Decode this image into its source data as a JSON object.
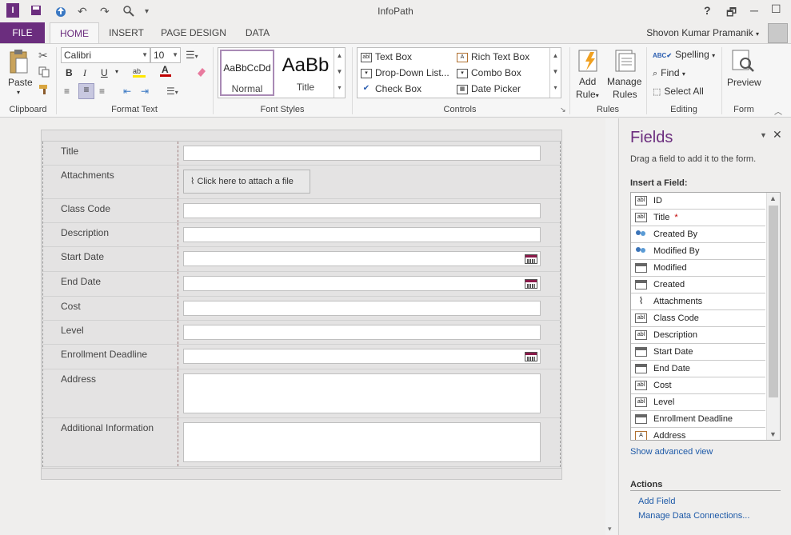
{
  "app": {
    "title": "InfoPath"
  },
  "window_controls": {
    "help": "?",
    "restore": "🗗",
    "minimize": "─",
    "maximize": "☐",
    "close": "✕"
  },
  "tabs": [
    {
      "label": "FILE"
    },
    {
      "label": "HOME"
    },
    {
      "label": "INSERT"
    },
    {
      "label": "PAGE DESIGN"
    },
    {
      "label": "DATA"
    }
  ],
  "user": {
    "name": "Shovon Kumar Pramanik"
  },
  "ribbon": {
    "clipboard": {
      "label": "Clipboard",
      "paste": "Paste"
    },
    "format_text": {
      "label": "Format Text",
      "font": "Calibri",
      "size": "10",
      "bold": "B",
      "italic": "I",
      "underline": "U"
    },
    "font_styles": {
      "label": "Font Styles",
      "normal_preview": "AaBbCcDd",
      "normal": "Normal",
      "title_preview": "AaBb",
      "title": "Title"
    },
    "controls": {
      "label": "Controls",
      "items": [
        "Text Box",
        "Rich Text Box",
        "Drop-Down List...",
        "Combo Box",
        "Check Box",
        "Date Picker"
      ]
    },
    "rules": {
      "label": "Rules",
      "add_rule": "Add Rule",
      "add_rule_2": "Rule",
      "add_rule_1": "Add",
      "manage_1": "Manage",
      "manage_2": "Rules"
    },
    "editing": {
      "label": "Editing",
      "spelling": "Spelling",
      "find": "Find",
      "select_all": "Select All"
    },
    "form": {
      "label": "Form",
      "preview": "Preview"
    }
  },
  "form": {
    "rows": [
      {
        "label": "Title",
        "kind": "text"
      },
      {
        "label": "Attachments",
        "kind": "attach",
        "button": "Click here to attach a file"
      },
      {
        "label": "Class Code",
        "kind": "text"
      },
      {
        "label": "Description",
        "kind": "text"
      },
      {
        "label": "Start Date",
        "kind": "date"
      },
      {
        "label": "End Date",
        "kind": "date"
      },
      {
        "label": "Cost",
        "kind": "text"
      },
      {
        "label": "Level",
        "kind": "text"
      },
      {
        "label": "Enrollment Deadline",
        "kind": "date"
      },
      {
        "label": "Address",
        "kind": "multi"
      },
      {
        "label": "Additional Information",
        "kind": "multi"
      }
    ]
  },
  "panel": {
    "title": "Fields",
    "hint": "Drag a field to add it to the form.",
    "insert_label": "Insert a Field:",
    "fields": [
      {
        "name": "ID",
        "icon": "abl"
      },
      {
        "name": "Title",
        "icon": "abl",
        "required": "*"
      },
      {
        "name": "Created By",
        "icon": "people"
      },
      {
        "name": "Modified By",
        "icon": "people"
      },
      {
        "name": "Modified",
        "icon": "datetime"
      },
      {
        "name": "Created",
        "icon": "datetime"
      },
      {
        "name": "Attachments",
        "icon": "clip"
      },
      {
        "name": "Class Code",
        "icon": "abl"
      },
      {
        "name": "Description",
        "icon": "abl"
      },
      {
        "name": "Start Date",
        "icon": "calendar"
      },
      {
        "name": "End Date",
        "icon": "calendar"
      },
      {
        "name": "Cost",
        "icon": "abl"
      },
      {
        "name": "Level",
        "icon": "abl"
      },
      {
        "name": "Enrollment Deadline",
        "icon": "calendar"
      },
      {
        "name": "Address",
        "icon": "richtext"
      }
    ],
    "show_advanced": "Show advanced view",
    "actions_label": "Actions",
    "add_field": "Add Field",
    "manage_connections": "Manage Data Connections..."
  },
  "colors": {
    "accent": "#6b2d7e",
    "link": "#1e5aa8"
  }
}
